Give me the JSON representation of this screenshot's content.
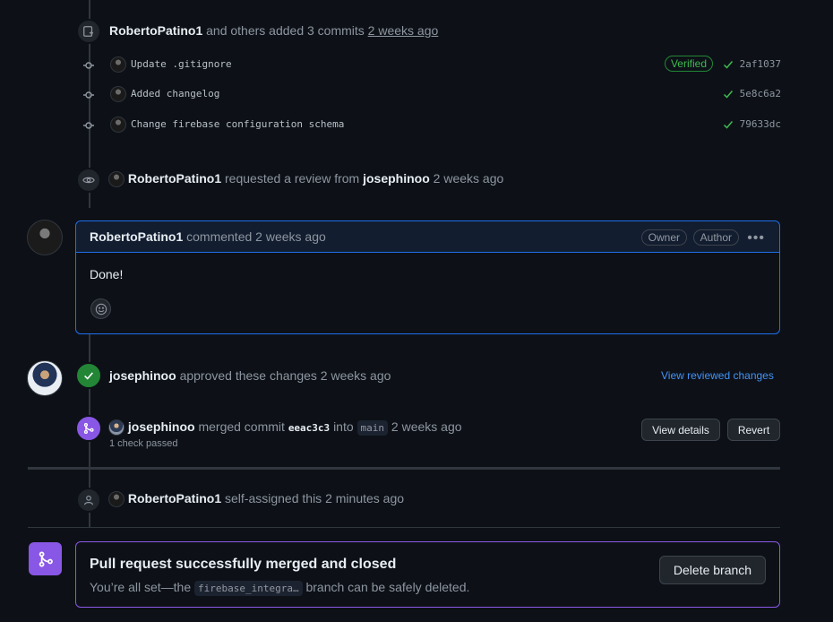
{
  "commits_event": {
    "actor": "RobertoPatino1",
    "text": "and others added 3 commits",
    "time": "2 weeks ago",
    "commits": [
      {
        "message": "Update .gitignore",
        "sha": "2af1037",
        "verified": "Verified"
      },
      {
        "message": "Added changelog",
        "sha": "5e8c6a2",
        "verified": ""
      },
      {
        "message": "Change firebase configuration schema",
        "sha": "79633dc",
        "verified": ""
      }
    ]
  },
  "review_request": {
    "actor": "RobertoPatino1",
    "text": "requested a review from",
    "target": "josephinoo",
    "time": "2 weeks ago"
  },
  "comment": {
    "author": "RobertoPatino1",
    "action": "commented",
    "time": "2 weeks ago",
    "labels": [
      "Owner",
      "Author"
    ],
    "body": "Done!"
  },
  "approval": {
    "actor": "josephinoo",
    "text": "approved these changes",
    "time": "2 weeks ago",
    "link": "View reviewed changes"
  },
  "merge_event": {
    "actor": "josephinoo",
    "text": "merged commit",
    "sha": "eeac3c3",
    "into": "into",
    "branch": "main",
    "time": "2 weeks ago",
    "checks": "1 check passed",
    "view_details": "View details",
    "revert": "Revert"
  },
  "self_assign": {
    "actor": "RobertoPatino1",
    "text": "self-assigned this",
    "time": "2 minutes ago"
  },
  "merged_box": {
    "title": "Pull request successfully merged and closed",
    "sub_before": "You’re all set—the",
    "branch": "firebase_integra…",
    "sub_after": "branch can be safely deleted.",
    "delete_button": "Delete branch"
  },
  "colors": {
    "accent_blue": "#1f6feb",
    "success_green": "#238636",
    "merged_purple": "#8957e5",
    "link_blue": "#4493f8"
  }
}
